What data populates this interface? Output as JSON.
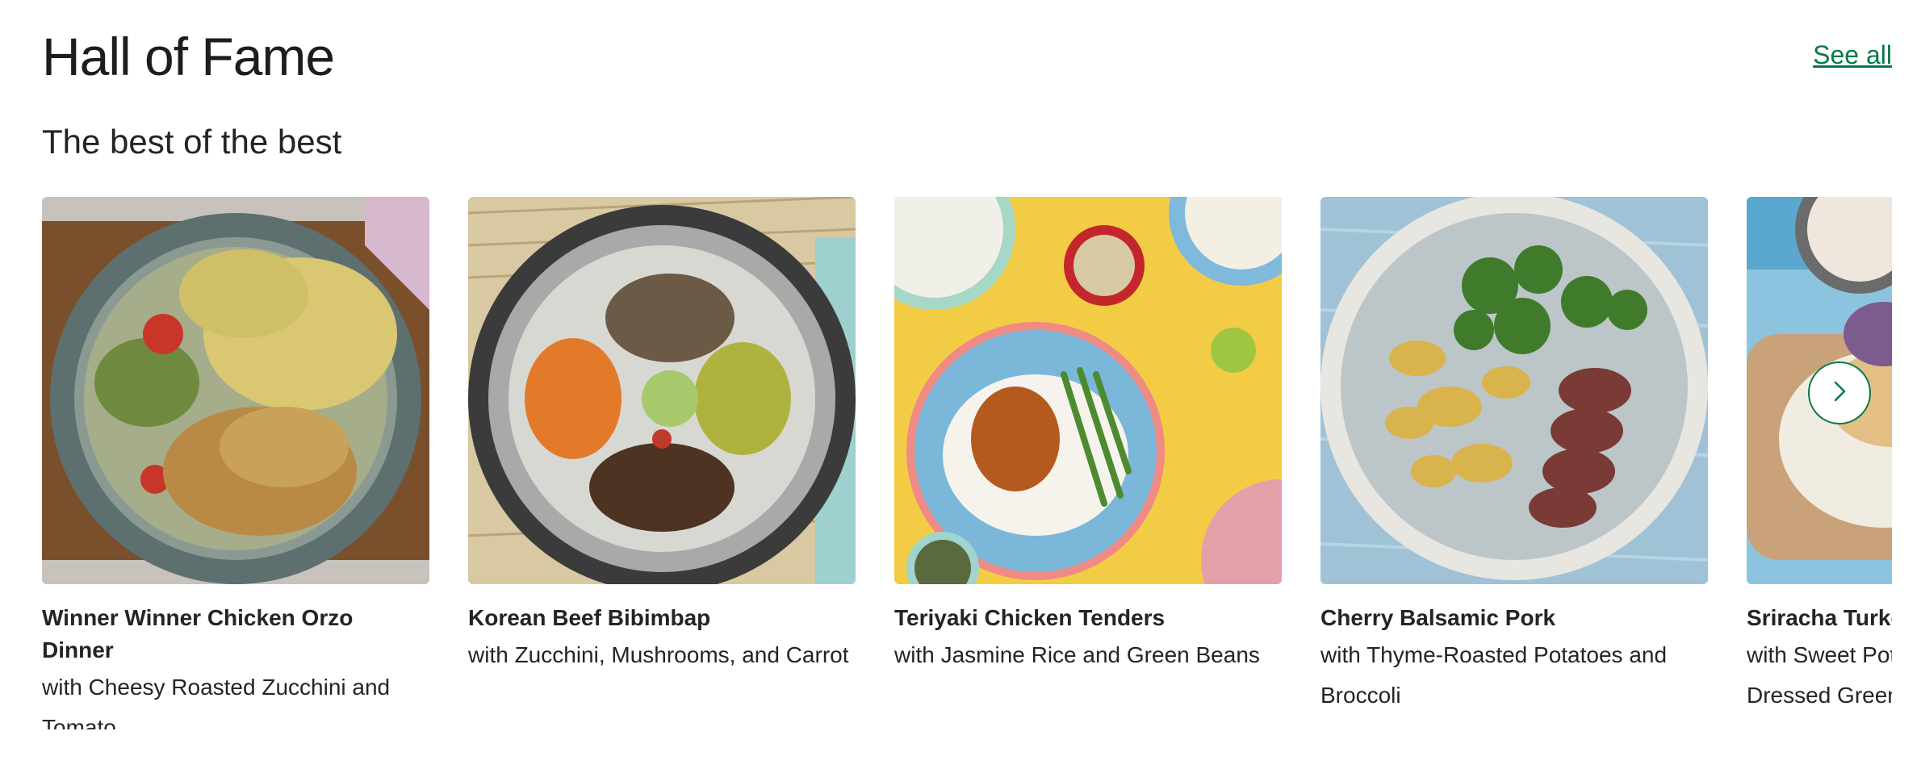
{
  "section": {
    "title": "Hall of Fame",
    "see_all_label": "See all",
    "subtitle": "The best of the best"
  },
  "colors": {
    "accent": "#067a46",
    "text": "#242424"
  },
  "carousel": {
    "next_icon": "chevron-right-icon",
    "cards": [
      {
        "name": "Winner Winner Chicken Orzo Dinner",
        "desc_line1": "with Cheesy Roasted Zucchini and",
        "desc_line2": "Tomato"
      },
      {
        "name": "Korean Beef Bibimbap",
        "desc_line1": "with Zucchini, Mushrooms, and Carrot",
        "desc_line2": ""
      },
      {
        "name": "Teriyaki Chicken Tenders",
        "desc_line1": "with Jasmine Rice and Green Beans",
        "desc_line2": ""
      },
      {
        "name": "Cherry Balsamic Pork",
        "desc_line1": "with Thyme-Roasted Potatoes and",
        "desc_line2": "Broccoli"
      },
      {
        "name": "Sriracha Turkey",
        "desc_line1": "with Sweet Pota",
        "desc_line2": "Dressed Greens"
      }
    ]
  }
}
